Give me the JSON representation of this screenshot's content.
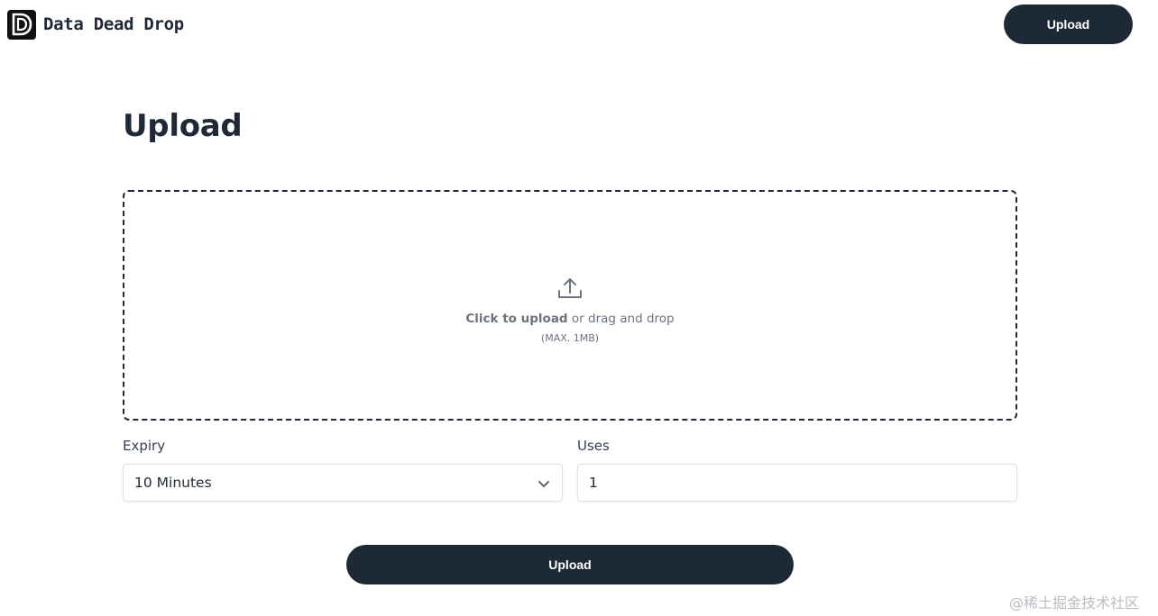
{
  "header": {
    "brand_name": "Data Dead Drop",
    "upload_button_label": "Upload"
  },
  "main": {
    "title": "Upload",
    "dropzone": {
      "click_text": "Click to upload",
      "rest_text": " or drag and drop",
      "max_text": "(MAX. 1MB)",
      "icon": "upload-tray-icon"
    },
    "expiry": {
      "label": "Expiry",
      "selected": "10 Minutes",
      "icon": "chevron-down-icon"
    },
    "uses": {
      "label": "Uses",
      "value": "1"
    },
    "submit_label": "Upload"
  },
  "watermark": "@稀土掘金技术社区",
  "colors": {
    "button_bg": "#1e2937",
    "text": "#1f2937",
    "muted": "#6b7280",
    "border": "#dcdfe4"
  }
}
